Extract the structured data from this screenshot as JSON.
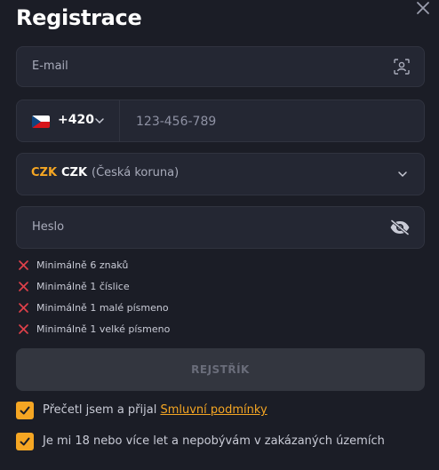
{
  "title": "Registrace",
  "email": {
    "label": "E-mail"
  },
  "phone": {
    "dial_code": "+420",
    "placeholder": "123-456-789"
  },
  "currency": {
    "code": "CZK",
    "name": "CZK",
    "full_name": "(Česká koruna)"
  },
  "password": {
    "label": "Heslo"
  },
  "password_rules": [
    {
      "text": "Minimálně 6 znaků"
    },
    {
      "text": "Minimálně 1 číslice"
    },
    {
      "text": "Minimálně 1 malé písmeno"
    },
    {
      "text": "Minimálně 1 velké písmeno"
    }
  ],
  "submit": {
    "label": "REJSTŘÍK"
  },
  "agreements": {
    "terms_prefix": "Přečetl jsem a přijal ",
    "terms_link": "Smluvní podmínky",
    "age": "Je mi 18 nebo více let a nepobývám v zakázaných územích"
  },
  "colors": {
    "accent": "#f5a623",
    "error": "#e0404a",
    "background": "#1b1d26",
    "field": "#242733"
  },
  "icons": {
    "close": "close-icon",
    "email": "user-scan-icon",
    "flag": "czech-flag-icon",
    "chevron": "chevron-down-icon",
    "eye": "eye-off-icon",
    "rule": "x-icon",
    "check": "check-icon"
  }
}
